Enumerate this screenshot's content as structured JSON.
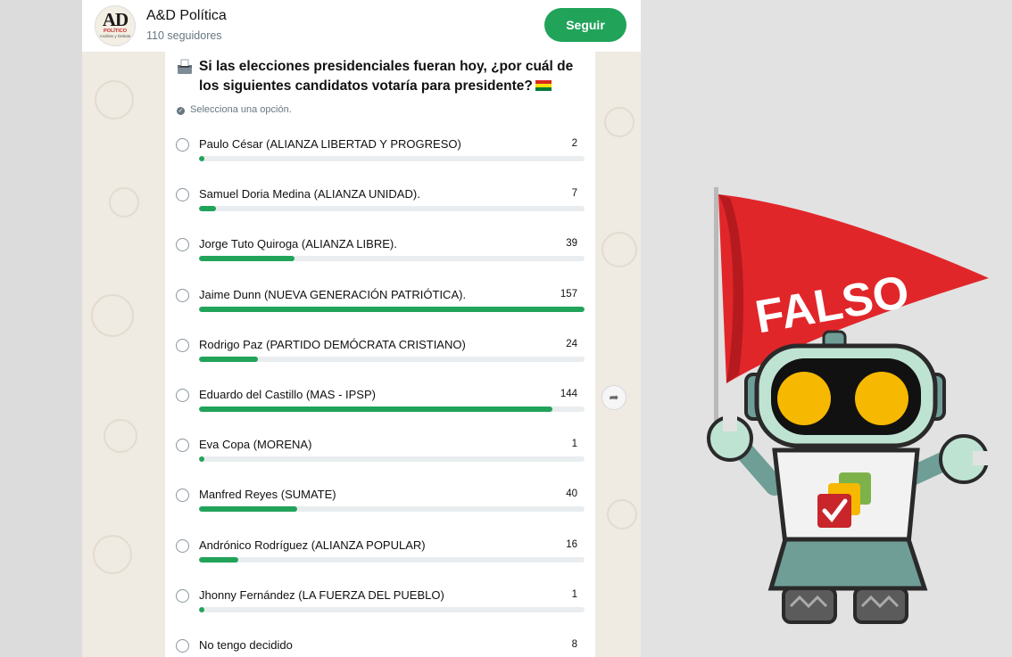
{
  "channel": {
    "name": "A&D Política",
    "followers": "110 seguidores",
    "follow_label": "Seguir",
    "avatar": {
      "main": "AD",
      "line1": "POLÍTICO",
      "line2": "Análisis y Debate"
    }
  },
  "poll": {
    "question": "Si las elecciones presidenciales fueran hoy, ¿por cuál de los siguientes candidatos votaría para presidente?",
    "hint": "Selecciona una opción.",
    "options": [
      {
        "label": "Paulo César (ALIANZA LIBERTAD Y PROGRESO)",
        "count": "2",
        "votes": 2
      },
      {
        "label": "Samuel Doria Medina (ALIANZA UNIDAD).",
        "count": "7",
        "votes": 7
      },
      {
        "label": "Jorge Tuto Quiroga (ALIANZA LIBRE).",
        "count": "39",
        "votes": 39
      },
      {
        "label": "Jaime Dunn (NUEVA GENERACIÓN PATRIÓTICA).",
        "count": "157",
        "votes": 157
      },
      {
        "label": "Rodrigo Paz (PARTIDO DEMÓCRATA CRISTIANO)",
        "count": "24",
        "votes": 24
      },
      {
        "label": "Eduardo del Castillo (MAS - IPSP)",
        "count": "144",
        "votes": 144
      },
      {
        "label": "Eva Copa (MORENA)",
        "count": "1",
        "votes": 1
      },
      {
        "label": "Manfred Reyes (SUMATE)",
        "count": "40",
        "votes": 40
      },
      {
        "label": "Andrónico Rodríguez (ALIANZA POPULAR)",
        "count": "16",
        "votes": 16
      },
      {
        "label": "Jhonny Fernández (LA FUERZA DEL PUEBLO)",
        "count": "1",
        "votes": 1
      },
      {
        "label": "No tengo decidido",
        "count": "8",
        "votes": 8
      }
    ]
  },
  "overlay": {
    "flag_text": "FALSO"
  },
  "icons": {
    "question": "ballot-box-icon",
    "hint": "check-circle-icon",
    "forward": "forward-icon",
    "flag": "bolivia-flag-icon"
  },
  "colors": {
    "accent": "#21a35a",
    "flag_red": "#e1262a",
    "eyes": "#f6b800",
    "robot_teal": "#6f9e97"
  }
}
